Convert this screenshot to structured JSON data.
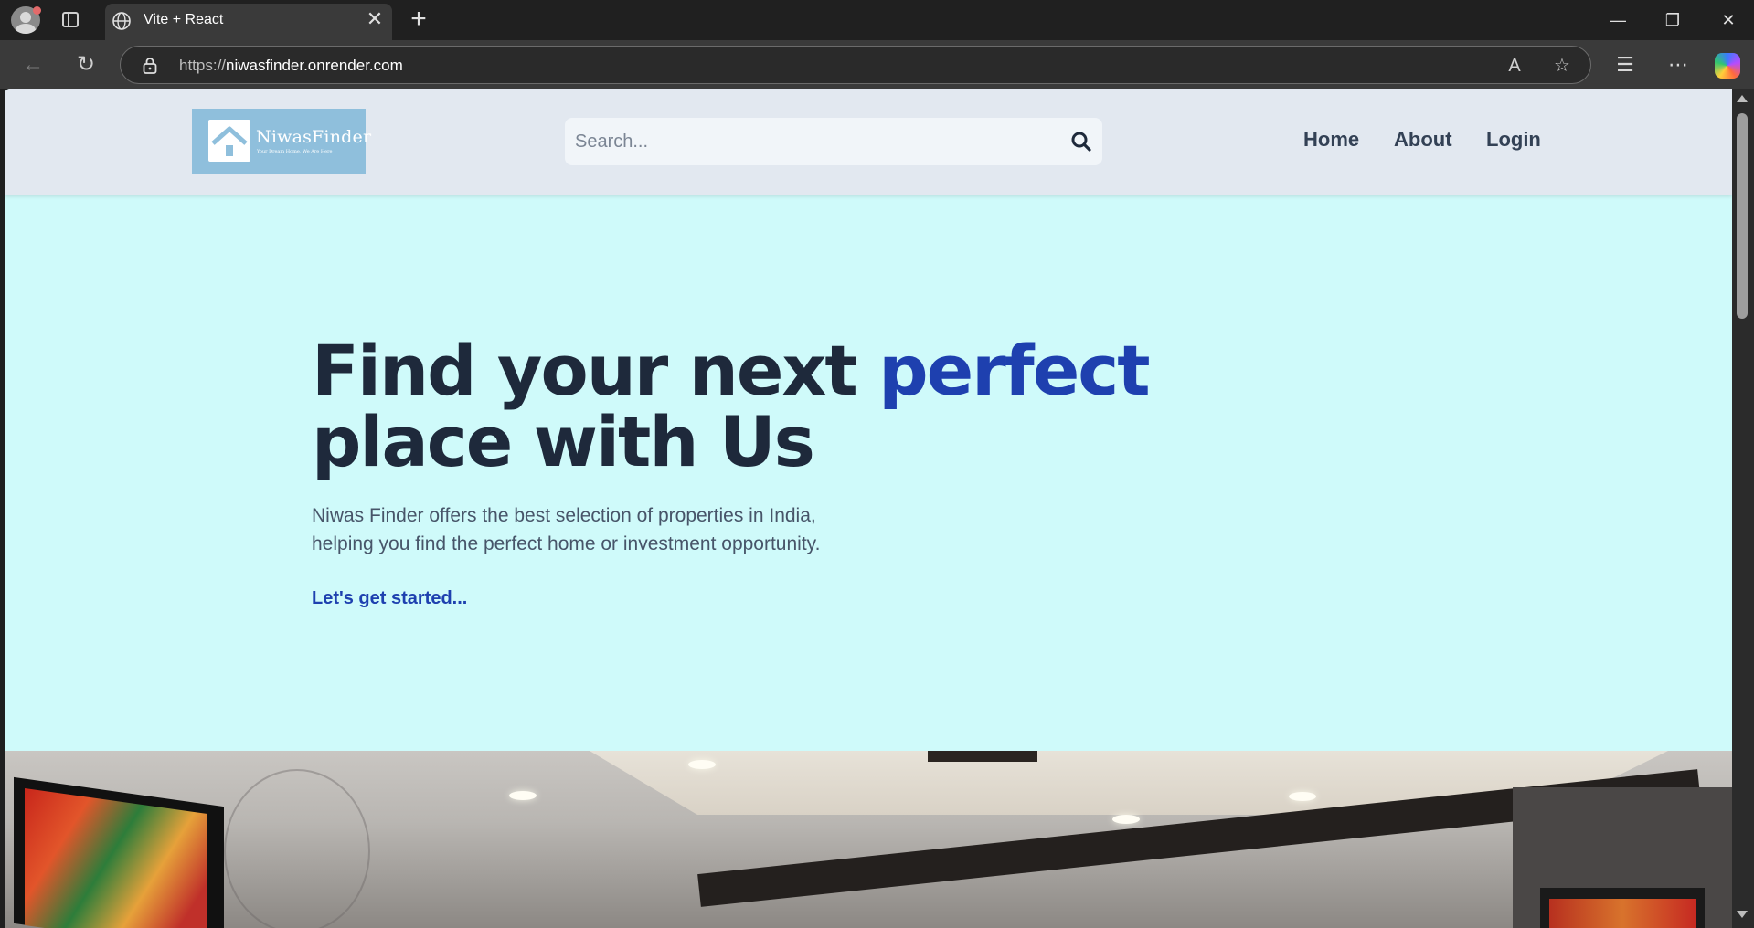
{
  "browser": {
    "tab_title": "Vite + React",
    "url_scheme": "https://",
    "url_host": "niwasfinder.onrender.com"
  },
  "site": {
    "logo_text": "NiwasFinder",
    "logo_tagline": "Your Dream Home, We Are Here",
    "search_placeholder": "Search...",
    "nav": {
      "home": "Home",
      "about": "About",
      "login": "Login"
    }
  },
  "hero": {
    "title_part1": "Find your next ",
    "title_accent": "perfect",
    "title_part2": "place with Us",
    "description": "Niwas Finder offers the best selection of properties in India, helping you find the perfect home or investment opportunity.",
    "cta": "Let's get started..."
  },
  "colors": {
    "header_bg": "#e2e8f0",
    "hero_bg": "#cffafa",
    "accent": "#1e40af",
    "heading": "#1e293b"
  }
}
